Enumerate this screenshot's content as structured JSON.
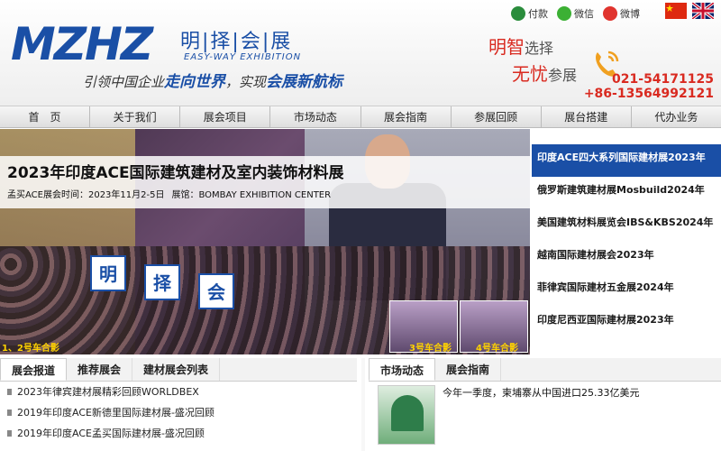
{
  "header": {
    "logo_main": "MZHZ",
    "logo_cn": "明|择|会|展",
    "logo_en": "EASY-WAY EXHIBITION",
    "slogan_prefix": "引领中国企业",
    "slogan_hl1": "走向世界",
    "slogan_mid": "，实现",
    "slogan_hl2": "会展新航标",
    "social": [
      {
        "label": "付款",
        "icon": "payment-icon",
        "color": "#2a8c3c"
      },
      {
        "label": "微信",
        "icon": "wechat-icon",
        "color": "#3cb034"
      },
      {
        "label": "微博",
        "icon": "weibo-icon",
        "color": "#e0342e"
      }
    ],
    "tagline1_red": "明智",
    "tagline1_grey": "选择",
    "tagline2_red": "无忧",
    "tagline2_grey": "参展",
    "phone1": "021-54171125",
    "phone2": "+86-13564992121"
  },
  "nav": {
    "items": [
      "首　页",
      "关于我们",
      "展会项目",
      "市场动态",
      "展会指南",
      "参展回顾",
      "展台搭建",
      "代办业务"
    ]
  },
  "banner": {
    "title": "2023年印度ACE国际建筑建材及室内装饰材料展",
    "time_label": "孟买ACE展会时间：2023年11月2-5日",
    "venue_label": "展馆：BOMBAY EXHIBITION CENTER",
    "thumb_labels": [
      "1、2号车合影",
      "3号车合影",
      "4号车合影"
    ],
    "sign_chars": [
      "明",
      "择",
      "会"
    ]
  },
  "side_list": {
    "items": [
      "印度ACE四大系列国际建材展2023年",
      "俄罗斯建筑建材展Mosbuild2024年",
      "美国建筑材料展览会IBS&KBS2024年",
      "越南国际建材展会2023年",
      "菲律宾国际建材五金展2024年",
      "印度尼西亚国际建材展2023年"
    ]
  },
  "panel_left": {
    "tabs": [
      "展会报道",
      "推荐展会",
      "建材展会列表"
    ],
    "news": [
      "2023年律宾建材展精彩回顾WORLDBEX",
      "2019年印度ACE新德里国际建材展-盛况回顾",
      "2019年印度ACE孟买国际建材展-盛况回顾"
    ]
  },
  "panel_right": {
    "tabs": [
      "市场动态",
      "展会指南"
    ],
    "headline": "今年一季度，柬埔寨从中国进口25.33亿美元"
  },
  "colors": {
    "brand_blue": "#1a4fa6",
    "accent_red": "#d92a20"
  }
}
